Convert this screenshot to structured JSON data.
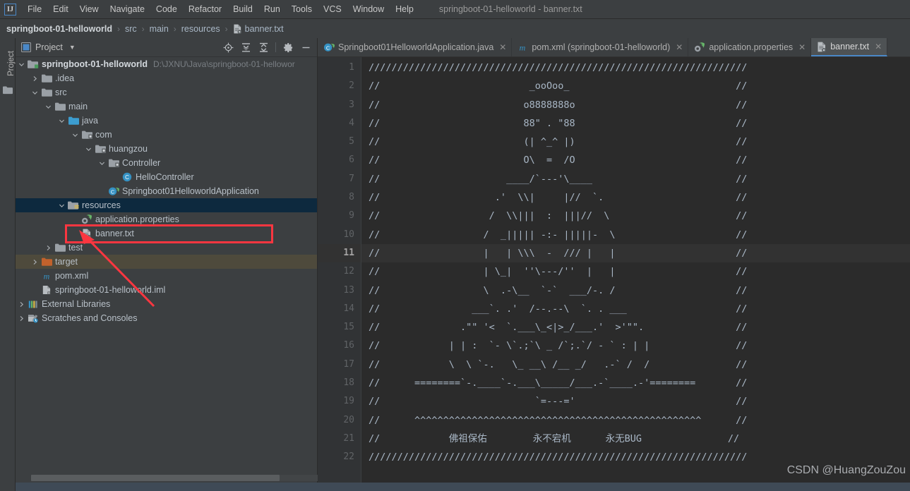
{
  "window": {
    "title": "springboot-01-helloworld - banner.txt",
    "logo_text": "IJ"
  },
  "menubar": {
    "items": [
      {
        "label": "File",
        "mnemonic": "F"
      },
      {
        "label": "Edit",
        "mnemonic": "E"
      },
      {
        "label": "View",
        "mnemonic": "V"
      },
      {
        "label": "Navigate",
        "mnemonic": "N"
      },
      {
        "label": "Code",
        "mnemonic": "C"
      },
      {
        "label": "Refactor",
        "mnemonic": "R"
      },
      {
        "label": "Build",
        "mnemonic": "B"
      },
      {
        "label": "Run",
        "mnemonic": "n"
      },
      {
        "label": "Tools",
        "mnemonic": "T"
      },
      {
        "label": "VCS",
        "mnemonic": "S"
      },
      {
        "label": "Window",
        "mnemonic": "W"
      },
      {
        "label": "Help",
        "mnemonic": "H"
      }
    ]
  },
  "breadcrumb": {
    "segments": [
      {
        "label": "springboot-01-helloworld",
        "bold": true,
        "icon": null
      },
      {
        "label": "src",
        "bold": false,
        "icon": null
      },
      {
        "label": "main",
        "bold": false,
        "icon": null
      },
      {
        "label": "resources",
        "bold": false,
        "icon": null
      },
      {
        "label": "banner.txt",
        "bold": false,
        "icon": "text-file-icon"
      }
    ],
    "separator": "›"
  },
  "left_strip": {
    "project_tab": "Project"
  },
  "project_panel": {
    "title": "Project",
    "dropdown_caret": "▼",
    "actions": [
      {
        "name": "locate-in-tree-icon",
        "tooltip": "Select Opened File"
      },
      {
        "name": "expand-all-icon",
        "tooltip": "Expand All"
      },
      {
        "name": "collapse-all-icon",
        "tooltip": "Collapse All"
      },
      {
        "name": "gear-icon",
        "tooltip": "Settings"
      },
      {
        "name": "hide-icon",
        "tooltip": "Hide"
      }
    ],
    "tree": [
      {
        "label": "springboot-01-helloworld",
        "path": "D:\\JXNU\\Java\\springboot-01-hellowor",
        "depth": 0,
        "arrow": "down",
        "icon": "module-folder-icon",
        "bold": true,
        "state": "none"
      },
      {
        "label": ".idea",
        "path": "",
        "depth": 1,
        "arrow": "right",
        "icon": "folder-icon",
        "bold": false,
        "state": "none"
      },
      {
        "label": "src",
        "path": "",
        "depth": 1,
        "arrow": "down",
        "icon": "folder-icon",
        "bold": false,
        "state": "none"
      },
      {
        "label": "main",
        "path": "",
        "depth": 2,
        "arrow": "down",
        "icon": "folder-icon",
        "bold": false,
        "state": "none"
      },
      {
        "label": "java",
        "path": "",
        "depth": 3,
        "arrow": "down",
        "icon": "source-folder-icon",
        "bold": false,
        "state": "none"
      },
      {
        "label": "com",
        "path": "",
        "depth": 4,
        "arrow": "down",
        "icon": "package-icon",
        "bold": false,
        "state": "none"
      },
      {
        "label": "huangzou",
        "path": "",
        "depth": 5,
        "arrow": "down",
        "icon": "package-icon",
        "bold": false,
        "state": "none"
      },
      {
        "label": "Controller",
        "path": "",
        "depth": 6,
        "arrow": "down",
        "icon": "package-icon",
        "bold": false,
        "state": "none"
      },
      {
        "label": "HelloController",
        "path": "",
        "depth": 7,
        "arrow": "none",
        "icon": "java-class-icon",
        "bold": false,
        "state": "none"
      },
      {
        "label": "Springboot01HelloworldApplication",
        "path": "",
        "depth": 6,
        "arrow": "none",
        "icon": "spring-boot-class-icon",
        "bold": false,
        "state": "none"
      },
      {
        "label": "resources",
        "path": "",
        "depth": 3,
        "arrow": "down",
        "icon": "resources-folder-icon",
        "bold": false,
        "state": "selected"
      },
      {
        "label": "application.properties",
        "path": "",
        "depth": 4,
        "arrow": "none",
        "icon": "spring-properties-icon",
        "bold": false,
        "state": "none"
      },
      {
        "label": "banner.txt",
        "path": "",
        "depth": 4,
        "arrow": "none",
        "icon": "text-file-icon",
        "bold": false,
        "state": "highlighted"
      },
      {
        "label": "test",
        "path": "",
        "depth": 2,
        "arrow": "right",
        "icon": "folder-icon",
        "bold": false,
        "state": "none"
      },
      {
        "label": "target",
        "path": "",
        "depth": 1,
        "arrow": "right",
        "icon": "target-folder-icon",
        "bold": false,
        "state": "inactive-selected"
      },
      {
        "label": "pom.xml",
        "path": "",
        "depth": 1,
        "arrow": "none",
        "icon": "maven-icon",
        "bold": false,
        "state": "none"
      },
      {
        "label": "springboot-01-helloworld.iml",
        "path": "",
        "depth": 1,
        "arrow": "none",
        "icon": "iml-icon",
        "bold": false,
        "state": "none"
      },
      {
        "label": "External Libraries",
        "path": "",
        "depth": 0,
        "arrow": "right",
        "icon": "libraries-icon",
        "bold": false,
        "state": "none"
      },
      {
        "label": "Scratches and Consoles",
        "path": "",
        "depth": 0,
        "arrow": "right",
        "icon": "scratches-icon",
        "bold": false,
        "state": "none"
      }
    ]
  },
  "editor": {
    "tabs": [
      {
        "label": "Springboot01HelloworldApplication.java",
        "icon": "spring-boot-class-icon",
        "active": false,
        "closable": true
      },
      {
        "label": "pom.xml (springboot-01-helloworld)",
        "icon": "maven-icon",
        "active": false,
        "closable": true
      },
      {
        "label": "application.properties",
        "icon": "spring-properties-icon",
        "active": false,
        "closable": true
      },
      {
        "label": "banner.txt",
        "icon": "text-file-icon",
        "active": true,
        "closable": true
      }
    ],
    "current_line": 11,
    "line_numbers": [
      1,
      2,
      3,
      4,
      5,
      6,
      7,
      8,
      9,
      10,
      11,
      12,
      13,
      14,
      15,
      16,
      17,
      18,
      19,
      20,
      21,
      22
    ],
    "lines": [
      "//////////////////////////////////////////////////////////////////",
      "//                          _ooOoo_                             //",
      "//                         o8888888o                            //",
      "//                         88\" . \"88                            //",
      "//                         (| ^_^ |)                            //",
      "//                         O\\  =  /O                            //",
      "//                      ____/`---'\\____                         //",
      "//                    .'  \\\\|     |//  `.                       //",
      "//                   /  \\\\|||  :  |||//  \\                      //",
      "//                  /  _||||| -:- |||||-  \\                     //",
      "//                  |   | \\\\\\  -  /// |   |                     //",
      "//                  | \\_|  ''\\---/''  |   |                     //",
      "//                  \\  .-\\__  `-`  ___/-. /                     //",
      "//                ___`. .'  /--.--\\  `. . ___                   //",
      "//              .\"\" '<  `.___\\_<|>_/___.'  >'\"\".                //",
      "//            | | :  `- \\`.;`\\ _ /`;.`/ - ` : | |               //",
      "//            \\  \\ `-.   \\_ __\\ /__ _/   .-` /  /               //",
      "//      ========`-.____`-.___\\_____/___.-`____.-'========       //",
      "//                           `=---='                            //",
      "//      ^^^^^^^^^^^^^^^^^^^^^^^^^^^^^^^^^^^^^^^^^^^^^^^^^^      //",
      "//            佛祖保佑        永不宕机      永无BUG               //",
      "//////////////////////////////////////////////////////////////////"
    ],
    "watermark": "CSDN @HuangZouZou"
  },
  "annotations": {
    "highlight_box": {
      "color": "#fb3640",
      "target": "banner.txt"
    },
    "arrow": {
      "color": "#fb3640",
      "points_to": "banner.txt"
    }
  }
}
